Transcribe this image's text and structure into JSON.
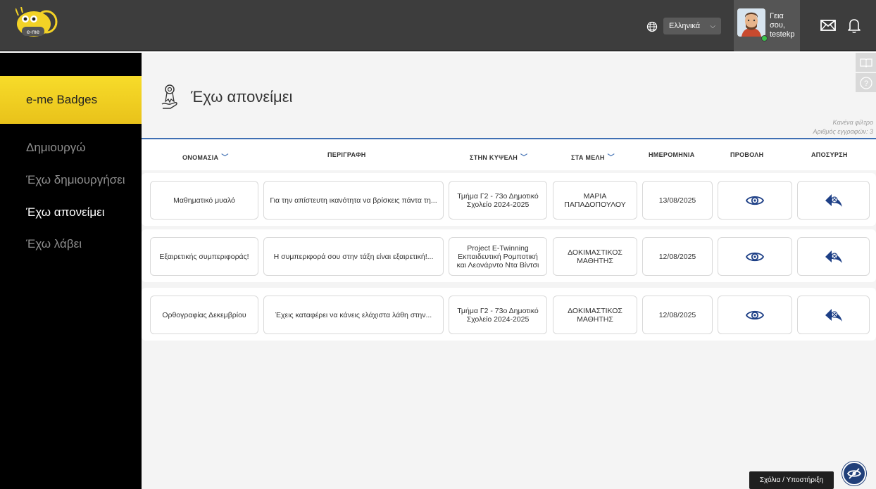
{
  "header": {
    "logo_label": "e-me",
    "language": "Ελληνικά",
    "greeting": "Γεια σου,",
    "username": "testekp",
    "icons": [
      "globe-icon",
      "mail-icon",
      "bell-icon"
    ]
  },
  "sidebar": {
    "title": "e-me Badges",
    "items": [
      {
        "label": "Δημιουργώ",
        "active": false
      },
      {
        "label": "Έχω δημιουργήσει",
        "active": false
      },
      {
        "label": "Έχω απονείμει",
        "active": true
      },
      {
        "label": "Έχω λάβει",
        "active": false
      }
    ]
  },
  "page": {
    "title": "Έχω απονείμει",
    "filter_text": "Κανένα φίλτρο",
    "records_text": "Αριθμός εγγραφών: 3"
  },
  "table": {
    "headers": [
      "ΟΝΟΜΑΣΙΑ",
      "ΠΕΡΙΓΡΑΦΗ",
      "ΣΤΗΝ ΚΥΨΕΛΗ",
      "ΣΤΑ ΜΕΛΗ",
      "ΗΜΕΡΟΜΗΝΙΑ",
      "ΠΡΟΒΟΛΗ",
      "ΑΠΟΣΥΡΣΗ"
    ],
    "rows": [
      {
        "name": "Μαθηματικό μυαλό",
        "description": "Για την απίστευτη ικανότητα να βρίσκεις πάντα τη...",
        "hive": "Τμήμα Γ2 - 73ο Δημοτικό Σχολείο 2024-2025",
        "member": "ΜΑΡΙΑ ΠΑΠΑΔΟΠΟΥΛΟΥ",
        "date": "13/08/2025"
      },
      {
        "name": "Εξαιρετικής συμπεριφοράς!",
        "description": "Η συμπεριφορά σου στην τάξη είναι εξαιρετική!...",
        "hive": "Project E-Twinning Εκπαιδευτική Ρομποτική και Λεονάρντο Ντα Βίντσι",
        "member": "ΔΟΚΙΜΑΣΤΙΚΟΣ ΜΑΘΗΤΗΣ",
        "date": "12/08/2025"
      },
      {
        "name": "Ορθογραφίας Δεκεμβρίου",
        "description": "Έχεις καταφέρει να κάνεις ελάχιστα λάθη στην...",
        "hive": "Τμήμα Γ2 - 73ο Δημοτικό Σχολείο 2024-2025",
        "member": "ΔΟΚΙΜΑΣΤΙΚΟΣ ΜΑΘΗΤΗΣ",
        "date": "12/08/2025"
      }
    ]
  },
  "footer": {
    "feedback_label": "Σχόλια / Υποστήριξη"
  },
  "colors": {
    "topbar": "#3d3d3d",
    "sidebar": "#000000",
    "accent_yellow": "#f3d226",
    "accent_blue": "#3f6fb3",
    "icon_blue": "#1d3f86"
  }
}
